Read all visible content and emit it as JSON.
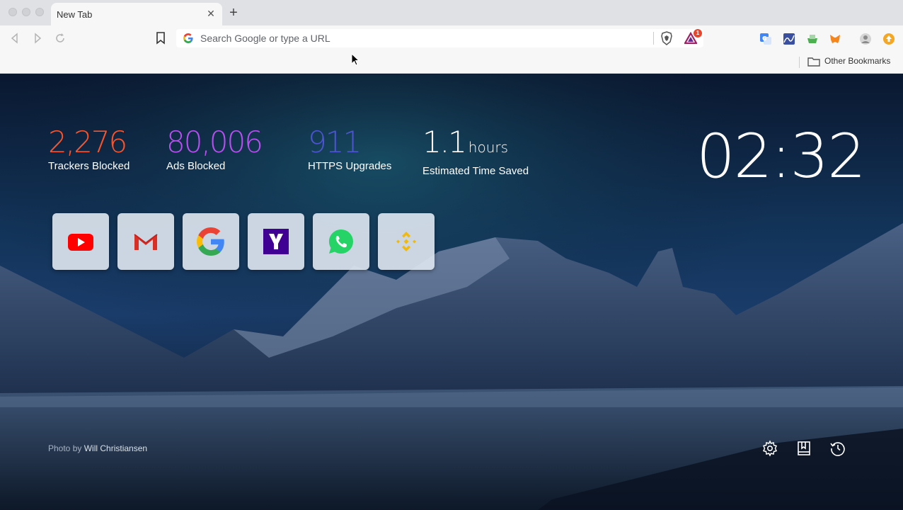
{
  "tab": {
    "title": "New Tab"
  },
  "omnibox": {
    "placeholder": "Search Google or type a URL"
  },
  "toolbar": {
    "rewards_badge": "1"
  },
  "bookmarks": {
    "other_label": "Other Bookmarks"
  },
  "stats": [
    {
      "value": "2,276",
      "unit": "",
      "label": "Trackers Blocked",
      "color": "#fb542b"
    },
    {
      "value": "80,006",
      "unit": "",
      "label": "Ads Blocked",
      "color": "#b94ff2"
    },
    {
      "value": "911",
      "unit": "",
      "label": "HTTPS Upgrades",
      "color": "#4c54d2"
    },
    {
      "value": "1.1",
      "unit": "hours",
      "label": "Estimated Time Saved",
      "color": "#ffffff"
    }
  ],
  "clock": "02:32",
  "top_sites": [
    "youtube",
    "gmail",
    "google",
    "yahoo",
    "whatsapp",
    "binance"
  ],
  "credit": {
    "prefix": "Photo by",
    "author": "Will Christiansen"
  }
}
